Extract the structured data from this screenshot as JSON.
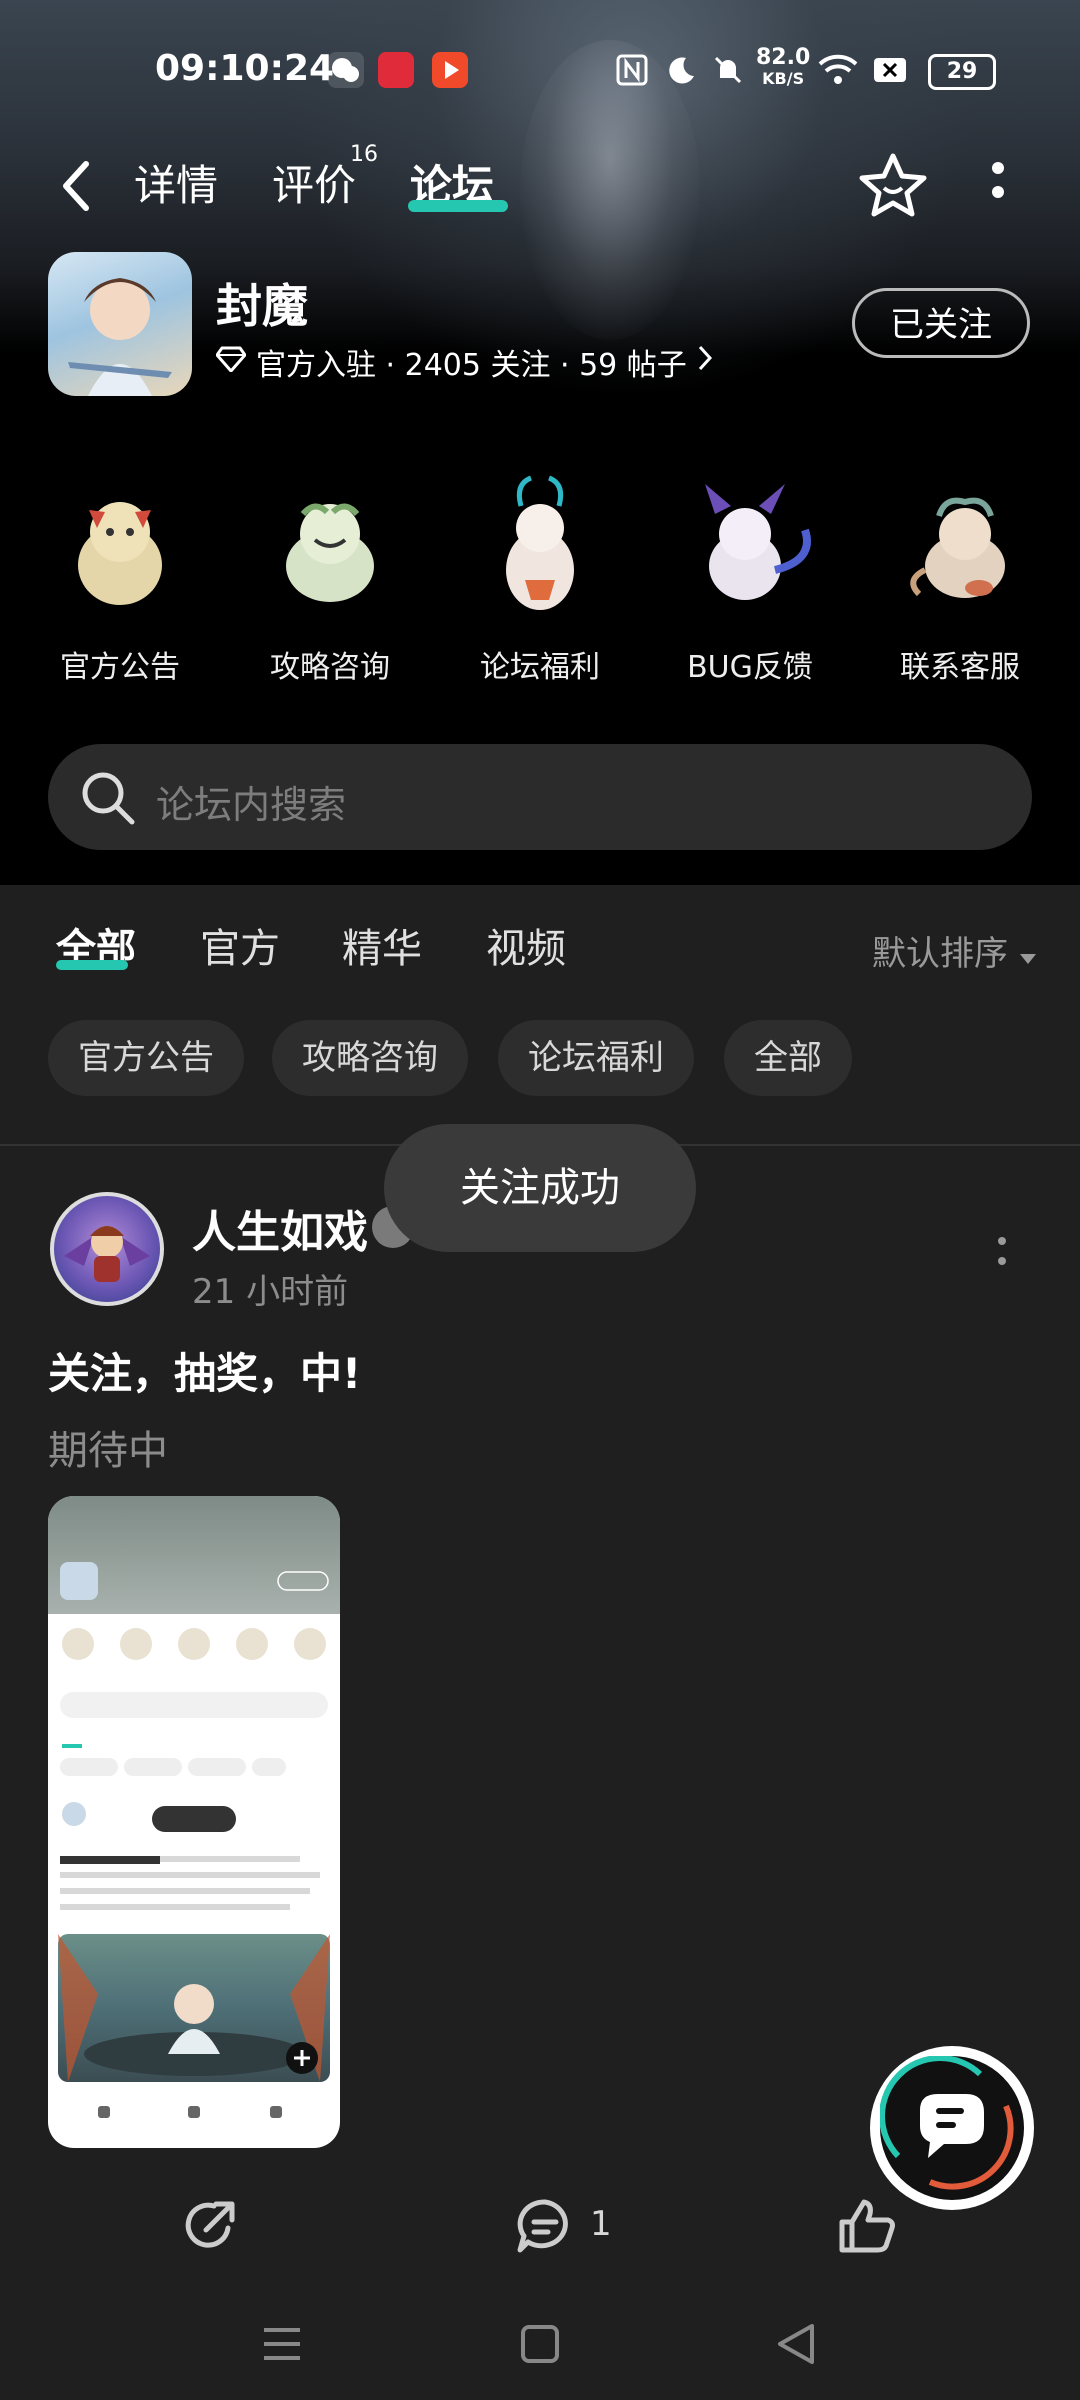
{
  "status": {
    "time": "09:10:24",
    "net_speed_value": "82.0",
    "net_speed_unit": "KB/S",
    "battery": "29"
  },
  "nav": {
    "tabs": [
      {
        "label": "详情"
      },
      {
        "label": "评价",
        "badge": "16"
      },
      {
        "label": "论坛",
        "active": true
      }
    ]
  },
  "app": {
    "name": "封魔",
    "meta": "官方入驻 · 2405 关注 · 59 帖子",
    "follow_label": "已关注"
  },
  "categories": [
    {
      "label": "官方公告"
    },
    {
      "label": "攻略咨询"
    },
    {
      "label": "论坛福利"
    },
    {
      "label": "BUG反馈"
    },
    {
      "label": "联系客服"
    }
  ],
  "search": {
    "placeholder": "论坛内搜索"
  },
  "tabs": [
    {
      "label": "全部",
      "active": true
    },
    {
      "label": "官方"
    },
    {
      "label": "精华"
    },
    {
      "label": "视频"
    }
  ],
  "sort": {
    "label": "默认排序"
  },
  "chips": [
    {
      "label": "官方公告"
    },
    {
      "label": "攻略咨询"
    },
    {
      "label": "论坛福利"
    },
    {
      "label": "全部"
    }
  ],
  "toast": {
    "text": "关注成功"
  },
  "post": {
    "author": "人生如戏",
    "time": "21 小时前",
    "title": "关注，抽奖，中!",
    "body": "期待中",
    "comment_count": "1"
  },
  "colors": {
    "accent": "#26c7b0",
    "background": "#1f1f1f",
    "header_bg": "#000000",
    "chip_bg": "#2d2d2d",
    "muted_text": "#8c8c8c"
  }
}
